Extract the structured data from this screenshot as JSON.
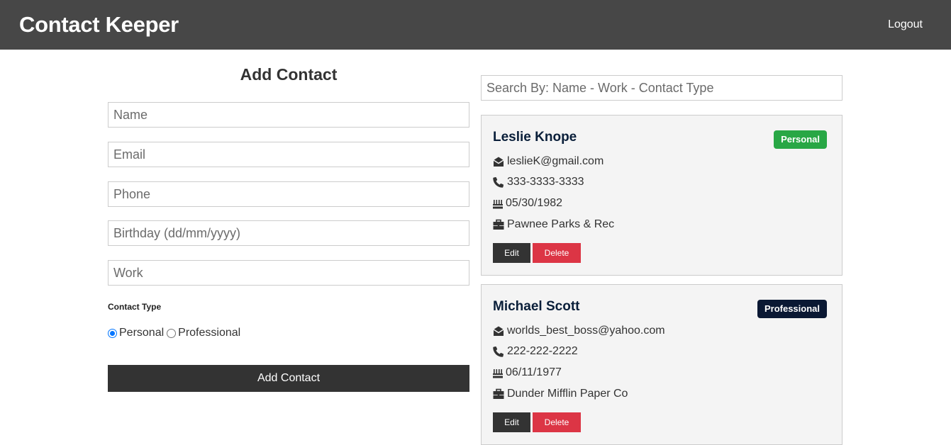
{
  "navbar": {
    "brand": "Contact Keeper",
    "logout": "Logout"
  },
  "form": {
    "title": "Add Contact",
    "fields": [
      {
        "placeholder": "Name"
      },
      {
        "placeholder": "Email"
      },
      {
        "placeholder": "Phone"
      },
      {
        "placeholder": "Birthday (dd/mm/yyyy)"
      },
      {
        "placeholder": "Work"
      }
    ],
    "contact_type_label": "Contact Type",
    "radio_personal": "Personal",
    "radio_professional": "Professional",
    "selected_type": "Personal",
    "submit_label": "Add Contact"
  },
  "search": {
    "placeholder": "Search By: Name - Work - Contact Type"
  },
  "contacts": [
    {
      "name": "Leslie Knope",
      "type": "Personal",
      "email": "leslieK@gmail.com",
      "phone": "333-3333-3333",
      "birthday": "05/30/1982",
      "work": "Pawnee Parks & Rec",
      "edit_label": "Edit",
      "delete_label": "Delete"
    },
    {
      "name": "Michael Scott",
      "type": "Professional",
      "email": "worlds_best_boss@yahoo.com",
      "phone": "222-222-2222",
      "birthday": "06/11/1977",
      "work": "Dunder Mifflin Paper Co",
      "edit_label": "Edit",
      "delete_label": "Delete"
    }
  ],
  "colors": {
    "navbar": "#474747",
    "dark": "#333333",
    "personal_badge": "#28a745",
    "professional_badge": "#0a1833",
    "delete": "#dc3545",
    "card_bg": "#f4f4f4"
  }
}
